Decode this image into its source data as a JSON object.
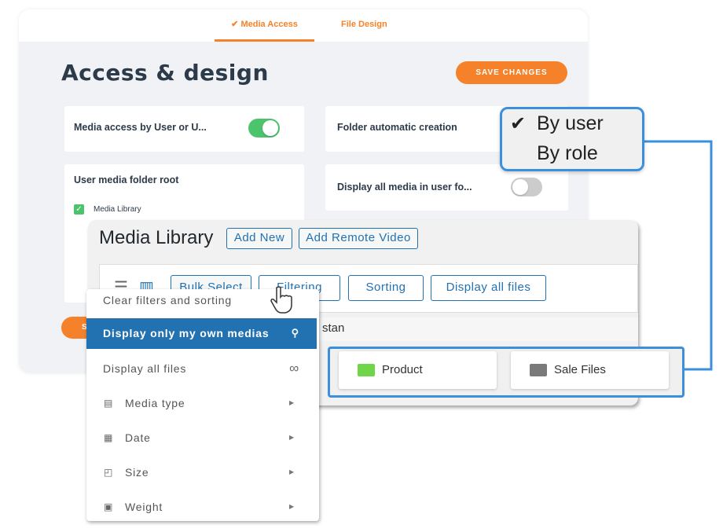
{
  "tabs": [
    {
      "label": "Media Access",
      "active": true
    },
    {
      "label": "File Design",
      "active": false
    }
  ],
  "settings": {
    "title": "Access & design",
    "save_label": "SAVE CHANGES",
    "save_label_bottom": "S",
    "media_access": {
      "label": "Media access by User or U...",
      "enabled": true
    },
    "folder_auto": {
      "label": "Folder automatic creation"
    },
    "folder_root": {
      "label": "User media folder root",
      "option": "Media Library",
      "checked": true
    },
    "display_all": {
      "label": "Display all media in user fo...",
      "enabled": false
    }
  },
  "role_dropdown": {
    "options": [
      {
        "label": "By user",
        "checked": true
      },
      {
        "label": "By role",
        "checked": false
      }
    ]
  },
  "media_library": {
    "title": "Media Library",
    "add_new": "Add New",
    "add_remote": "Add Remote Video",
    "toolbar": {
      "bulk": "Bulk Select",
      "filtering": "Filtering",
      "sorting": "Sorting",
      "display_all": "Display all files"
    },
    "row_text": "stan",
    "folders": [
      {
        "name": "Product",
        "color": "#6fd64a"
      },
      {
        "name": "Sale Files",
        "color": "#7a7a7a"
      }
    ]
  },
  "filter_menu": {
    "items": [
      {
        "label": "Clear filters and sorting"
      },
      {
        "label": "Display only my own medias",
        "icon": "user-icon",
        "active": true
      },
      {
        "label": "Display all files",
        "icon": "infinity-icon"
      },
      {
        "label": "Media type",
        "icon": "document-icon",
        "submenu": true
      },
      {
        "label": "Date",
        "icon": "calendar-icon",
        "submenu": true
      },
      {
        "label": "Size",
        "icon": "resize-icon",
        "submenu": true
      },
      {
        "label": "Weight",
        "icon": "weight-icon",
        "submenu": true
      }
    ]
  },
  "colors": {
    "accent": "#f5822a",
    "wp_blue": "#2271b1",
    "highlight": "#3b8fdd",
    "toggle_on": "#4cc46b"
  }
}
